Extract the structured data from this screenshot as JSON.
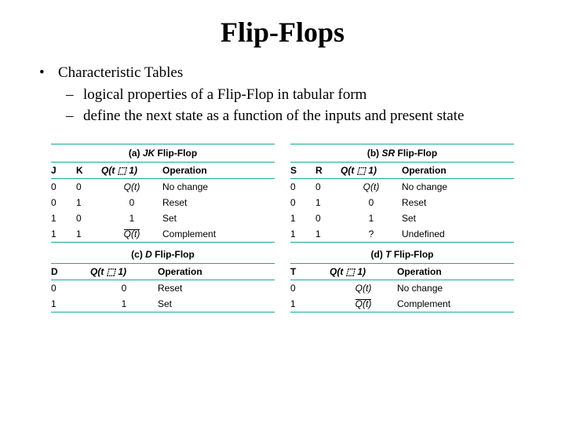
{
  "title": "Flip-Flops",
  "bullets": {
    "b1": "Characteristic Tables",
    "b2a": "logical properties of a Flip-Flop in tabular form",
    "b2b": "define the next state as a function of the inputs and present state"
  },
  "tables": {
    "jk": {
      "caption_prefix": "(a) ",
      "caption_type": "JK",
      "caption_suffix": " Flip-Flop",
      "h": {
        "c1": "J",
        "c2": "K",
        "c3": "Q(t ⬚ 1)",
        "c4": "Operation"
      },
      "r": [
        {
          "c1": "0",
          "c2": "0",
          "c3": "Q(t)",
          "c3_bar": false,
          "c4": "No change"
        },
        {
          "c1": "0",
          "c2": "1",
          "c3": "0",
          "c3_bar": false,
          "c4": "Reset"
        },
        {
          "c1": "1",
          "c2": "0",
          "c3": "1",
          "c3_bar": false,
          "c4": "Set"
        },
        {
          "c1": "1",
          "c2": "1",
          "c3": "Q(t)",
          "c3_bar": true,
          "c4": "Complement"
        }
      ]
    },
    "sr": {
      "caption_prefix": "(b) ",
      "caption_type": "SR",
      "caption_suffix": " Flip-Flop",
      "h": {
        "c1": "S",
        "c2": "R",
        "c3": "Q(t ⬚ 1)",
        "c4": "Operation"
      },
      "r": [
        {
          "c1": "0",
          "c2": "0",
          "c3": "Q(t)",
          "c3_bar": false,
          "c4": "No change"
        },
        {
          "c1": "0",
          "c2": "1",
          "c3": "0",
          "c3_bar": false,
          "c4": "Reset"
        },
        {
          "c1": "1",
          "c2": "0",
          "c3": "1",
          "c3_bar": false,
          "c4": "Set"
        },
        {
          "c1": "1",
          "c2": "1",
          "c3": "?",
          "c3_bar": false,
          "c4": "Undefined"
        }
      ]
    },
    "d": {
      "caption_prefix": "(c) ",
      "caption_type": "D",
      "caption_suffix": " Flip-Flop",
      "h": {
        "c1": "D",
        "c3": "Q(t ⬚ 1)",
        "c4": "Operation"
      },
      "r": [
        {
          "c1": "0",
          "c3": "0",
          "c3_bar": false,
          "c4": "Reset"
        },
        {
          "c1": "1",
          "c3": "1",
          "c3_bar": false,
          "c4": "Set"
        }
      ]
    },
    "t": {
      "caption_prefix": "(d) ",
      "caption_type": "T",
      "caption_suffix": " Flip-Flop",
      "h": {
        "c1": "T",
        "c3": "Q(t ⬚ 1)",
        "c4": "Operation"
      },
      "r": [
        {
          "c1": "0",
          "c3": "Q(t)",
          "c3_bar": false,
          "c4": "No change"
        },
        {
          "c1": "1",
          "c3": "Q(t)",
          "c3_bar": true,
          "c4": "Complement"
        }
      ]
    }
  }
}
